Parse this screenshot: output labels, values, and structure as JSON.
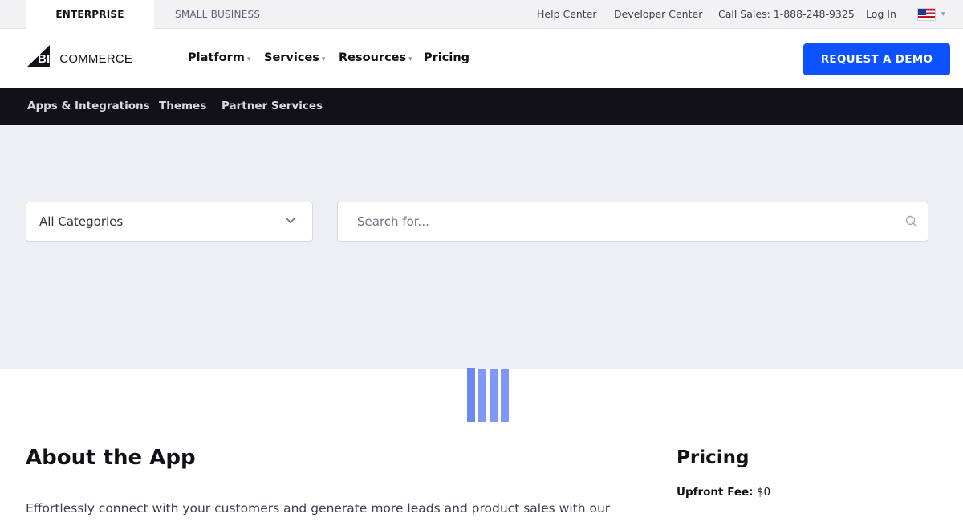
{
  "topbar": {
    "tabs": [
      "ENTERPRISE",
      "SMALL BUSINESS"
    ],
    "links": {
      "help": "Help Center",
      "developer": "Developer Center",
      "sales": "Call Sales: 1-888-248-9325",
      "login": "Log In"
    },
    "locale_icon": "us-flag-icon"
  },
  "nav": {
    "logo_text": "BIGCOMMERCE",
    "logo_big": "BIG",
    "logo_rest": "COMMERCE",
    "items": [
      "Platform",
      "Services",
      "Resources",
      "Pricing"
    ],
    "cta": "REQUEST A DEMO",
    "cta_color": "#0d52ff"
  },
  "subnav": {
    "items": [
      "Apps & Integrations",
      "Themes",
      "Partner Services"
    ]
  },
  "filters": {
    "category_selected": "All Categories",
    "search_placeholder": "Search for..."
  },
  "content": {
    "about_title": "About the App",
    "about_text": "Effortlessly connect with your customers and generate more leads and product sales with our",
    "pricing_title": "Pricing",
    "upfront_fee_label": "Upfront Fee:",
    "upfront_fee_value": "$0"
  }
}
